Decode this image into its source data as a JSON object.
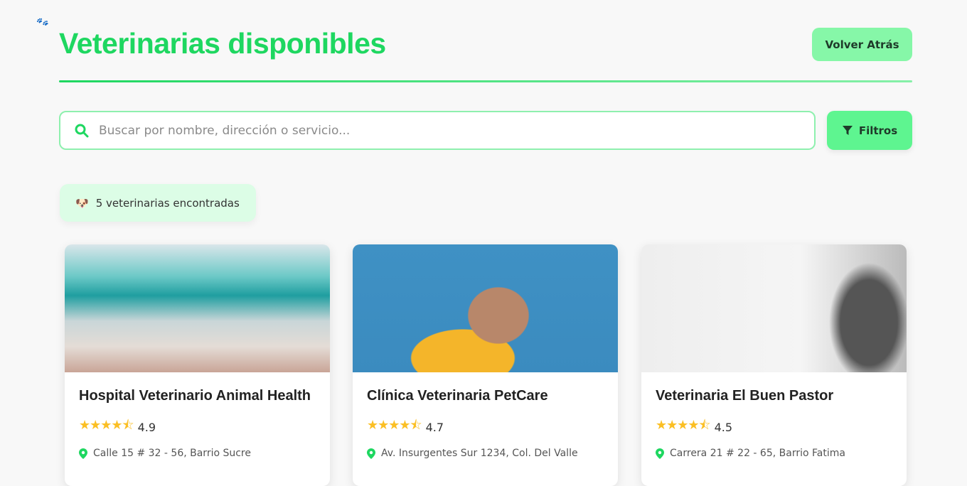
{
  "header": {
    "title": "Veterinarias disponibles",
    "back_label": "Volver Atrás"
  },
  "search": {
    "placeholder": "Buscar por nombre, dirección o servicio...",
    "filters_label": "Filtros"
  },
  "results": {
    "count_text": "5 veterinarias encontradas"
  },
  "cards": [
    {
      "name": "Hospital Veterinario Animal Health",
      "rating": "4.9",
      "address": "Calle 15 # 32 - 56, Barrio Sucre"
    },
    {
      "name": "Clínica Veterinaria PetCare",
      "rating": "4.7",
      "address": "Av. Insurgentes Sur 1234, Col. Del Valle"
    },
    {
      "name": "Veterinaria El Buen Pastor",
      "rating": "4.5",
      "address": "Carrera 21 # 22 - 65, Barrio Fatima"
    }
  ],
  "colors": {
    "accent": "#1ed760",
    "star": "#fbbf24"
  }
}
